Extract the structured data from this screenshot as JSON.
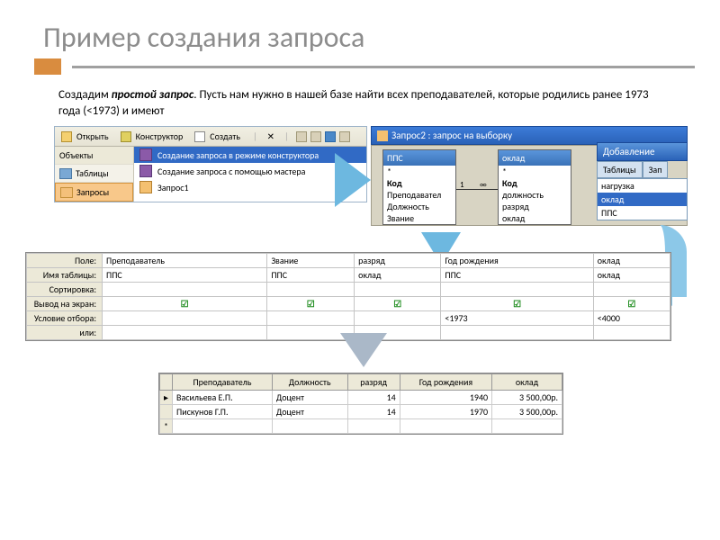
{
  "title": "Пример создания запроса",
  "body": {
    "lead": "Создадим ",
    "bold": "простой запрос",
    "rest": ". Пусть нам нужно в нашей базе найти всех преподавателей, которые родились ранее 1973 года (<1973) и имеют"
  },
  "toolbar": {
    "open": "Открыть",
    "design": "Конструктор",
    "create": "Создать"
  },
  "sidebar": {
    "objects": "Объекты",
    "tables": "Таблицы",
    "queries": "Запросы"
  },
  "content": {
    "row1": "Создание запроса в режиме конструктора",
    "row2": "Создание запроса с помощью мастера",
    "row3": "Запрос1"
  },
  "queryWindow": {
    "title": "Запрос2 : запрос на выборку"
  },
  "addTable": {
    "header": "Добавление",
    "tab1": "Таблицы",
    "tab2": "Зап",
    "item1": "нагрузка",
    "item2": "оклад",
    "item3": "ППС"
  },
  "fieldList1": {
    "header": "ППС",
    "f0": "*",
    "f1": "Код",
    "f2": "Преподавател",
    "f3": "Должность",
    "f4": "Звание"
  },
  "fieldList2": {
    "header": "оклад",
    "f0": "*",
    "f1": "Код",
    "f2": "должность",
    "f3": "разряд",
    "f4": "оклад"
  },
  "relation": {
    "one": "1",
    "inf": "∞"
  },
  "designGrid": {
    "labels": {
      "field": "Поле:",
      "table": "Имя таблицы:",
      "sort": "Сортировка:",
      "show": "Вывод на экран:",
      "criteria": "Условие отбора:",
      "or": "или:"
    },
    "cols": [
      {
        "field": "Преподаватель",
        "table": "ППС",
        "show": true,
        "crit": ""
      },
      {
        "field": "Звание",
        "table": "ППС",
        "show": true,
        "crit": ""
      },
      {
        "field": "разряд",
        "table": "оклад",
        "show": true,
        "crit": ""
      },
      {
        "field": "Год рождения",
        "table": "ППС",
        "show": true,
        "crit": "<1973"
      },
      {
        "field": "оклад",
        "table": "оклад",
        "show": true,
        "crit": "<4000"
      }
    ]
  },
  "result": {
    "headers": [
      "Преподаватель",
      "Должность",
      "разряд",
      "Год рождения",
      "оклад"
    ],
    "rows": [
      {
        "c0": "Васильева Е.П.",
        "c1": "Доцент",
        "c2": "14",
        "c3": "1940",
        "c4": "3 500,00р."
      },
      {
        "c0": "Пискунов Г.П.",
        "c1": "Доцент",
        "c2": "14",
        "c3": "1970",
        "c4": "3 500,00р."
      }
    ]
  }
}
